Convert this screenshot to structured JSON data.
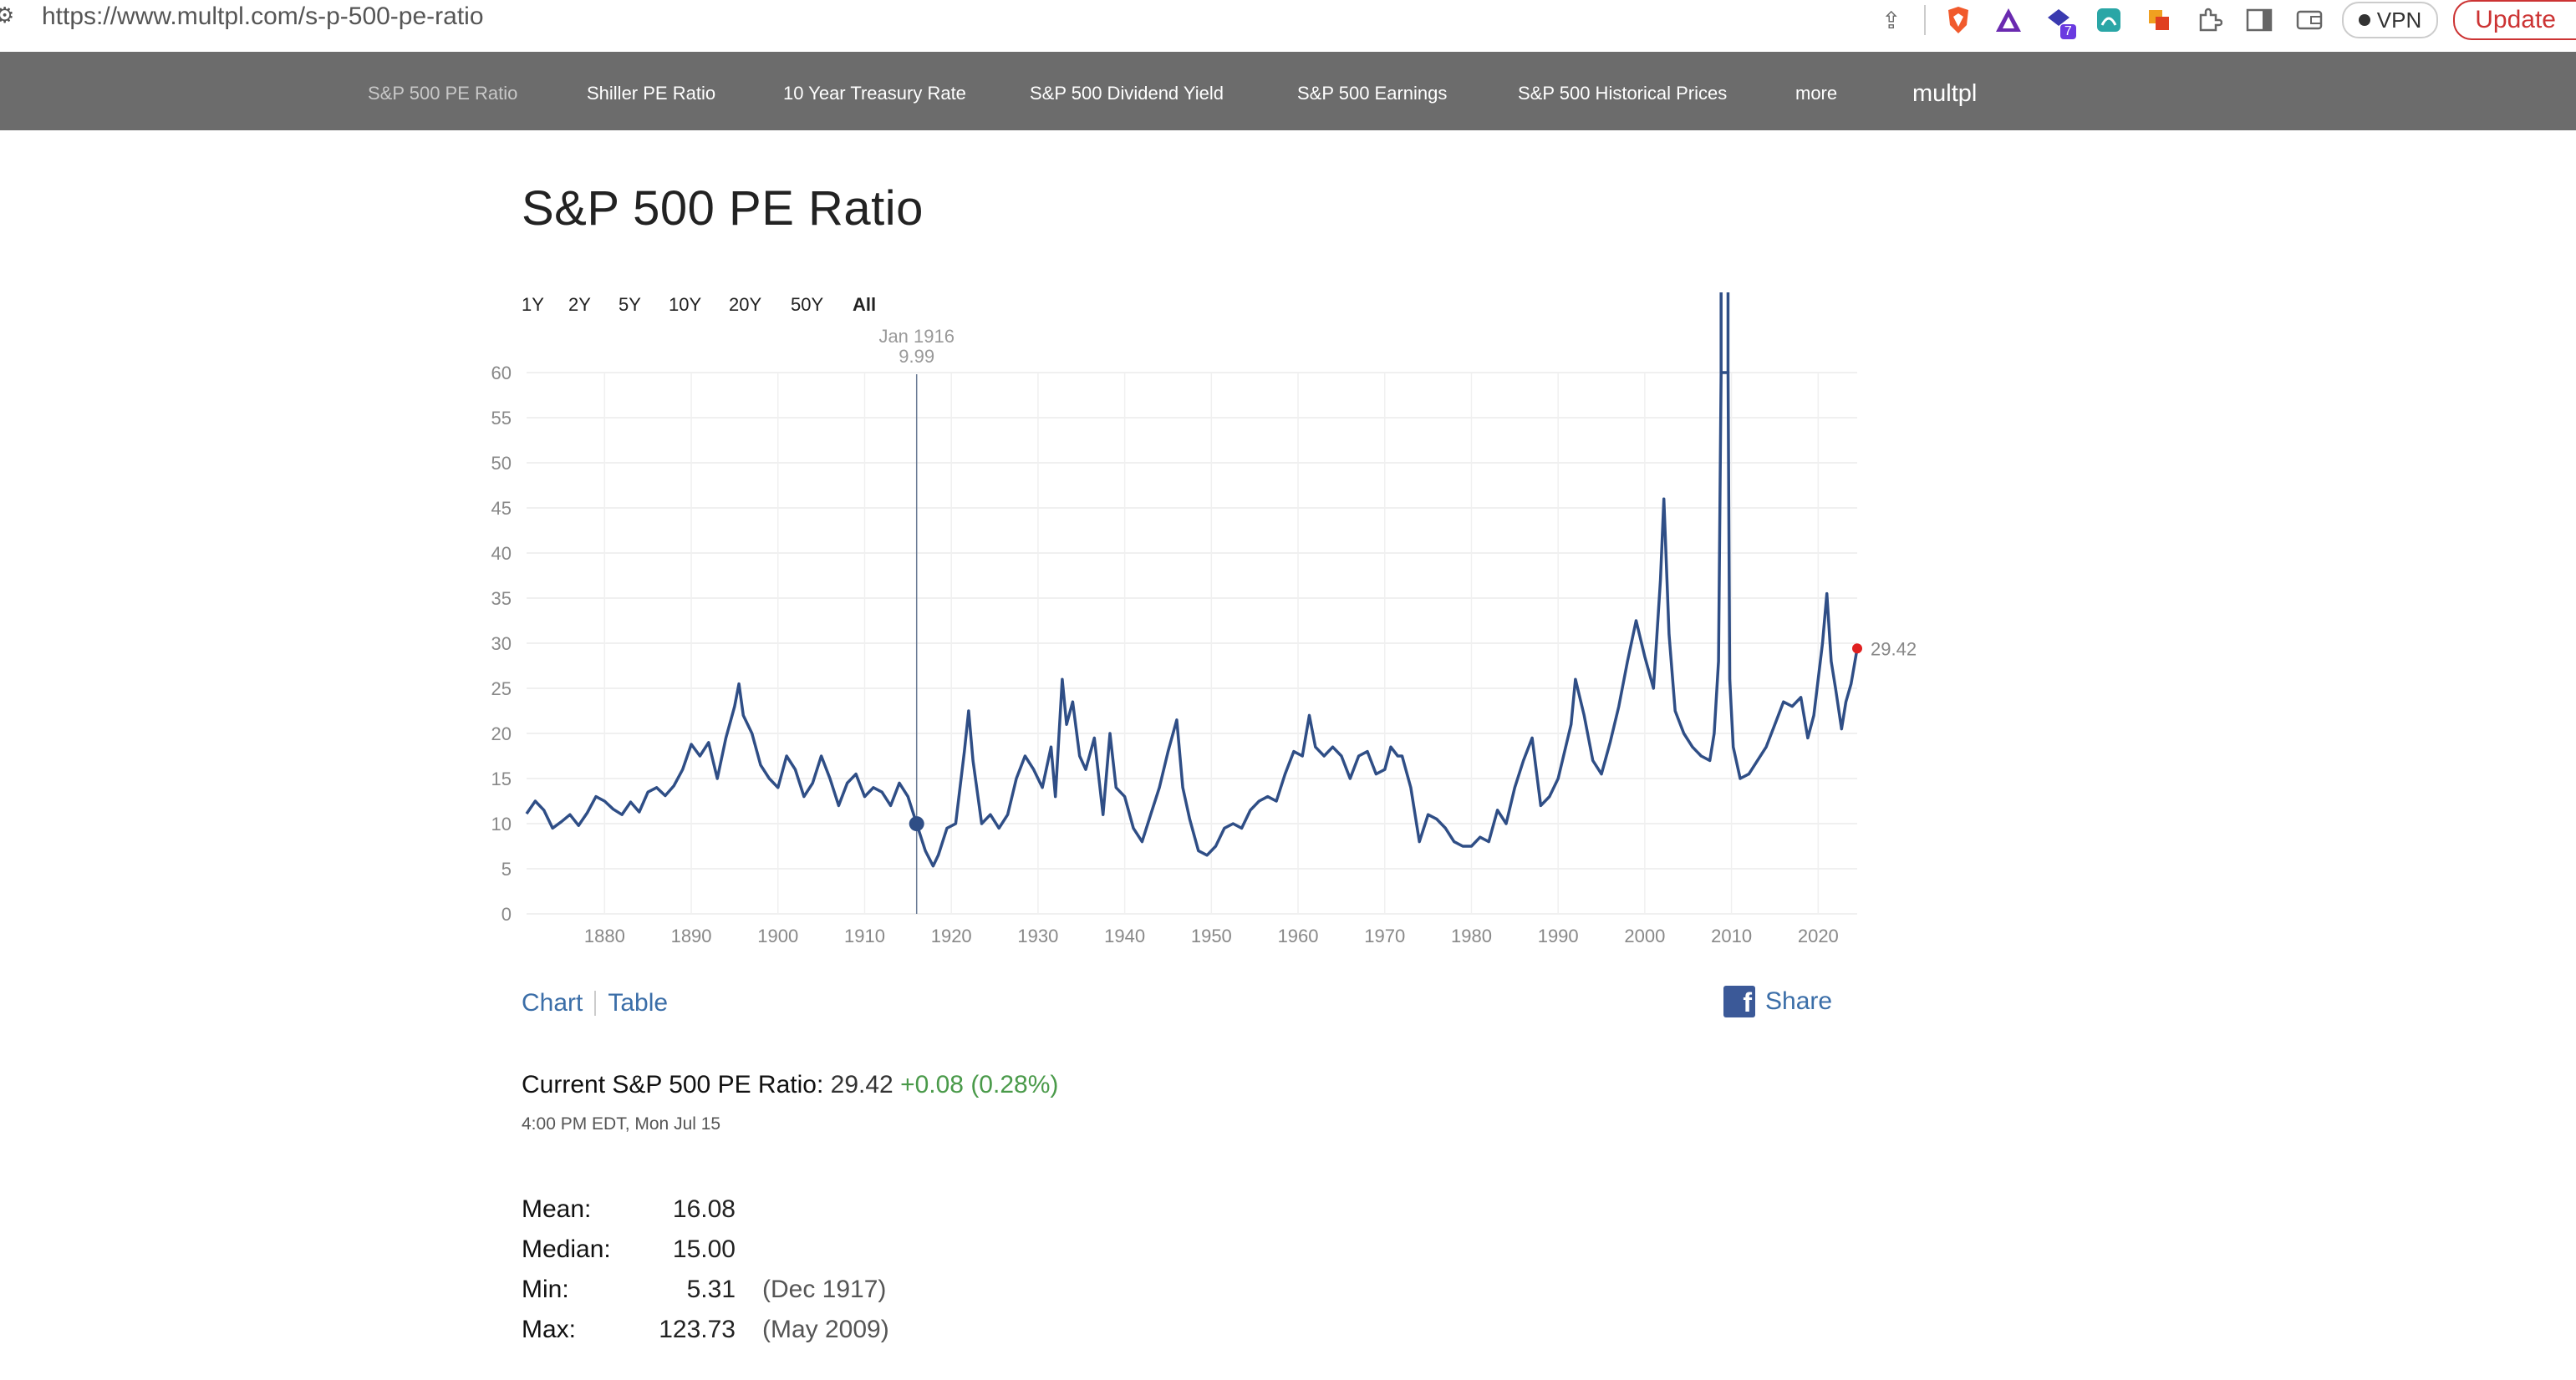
{
  "browser": {
    "url": "https://www.multpl.com/s-p-500-pe-ratio",
    "vpn_label": "VPN",
    "update_label": "Update",
    "extension_badge": "7"
  },
  "nav": {
    "items": [
      {
        "label": "S&P 500 PE Ratio",
        "active": true
      },
      {
        "label": "Shiller PE Ratio"
      },
      {
        "label": "10 Year Treasury Rate"
      },
      {
        "label": "S&P 500 Dividend Yield"
      },
      {
        "label": "S&P 500 Earnings"
      },
      {
        "label": "S&P 500 Historical Prices"
      },
      {
        "label": "more"
      }
    ],
    "brand": "multpl"
  },
  "page": {
    "title": "S&P 500 PE Ratio",
    "ranges": [
      "1Y",
      "2Y",
      "5Y",
      "10Y",
      "20Y",
      "50Y",
      "All"
    ],
    "selected_range": "All",
    "view_toggle": {
      "chart": "Chart",
      "table": "Table"
    },
    "share_label": "Share"
  },
  "current": {
    "label": "Current S&P 500 PE Ratio:",
    "value": "29.42",
    "change": "+0.08 (0.28%)",
    "timestamp": "4:00 PM EDT, Mon Jul 15"
  },
  "stats": [
    {
      "label": "Mean:",
      "value": "16.08",
      "date": ""
    },
    {
      "label": "Median:",
      "value": "15.00",
      "date": ""
    },
    {
      "label": "Min:",
      "value": "5.31",
      "date": "(Dec 1917)"
    },
    {
      "label": "Max:",
      "value": "123.73",
      "date": "(May 2009)"
    }
  ],
  "colors": {
    "line": "#2f4e86",
    "last_point": "#e02020",
    "nav_bg": "#6c6c6c",
    "link": "#3b6ea8",
    "change_positive": "#4a9a4a"
  },
  "chart_data": {
    "type": "line",
    "xlabel": "",
    "ylabel": "",
    "xlim": [
      1871,
      2024.5
    ],
    "ylim": [
      0,
      60
    ],
    "y_ticks": [
      0,
      5,
      10,
      15,
      20,
      25,
      30,
      35,
      40,
      45,
      50,
      55,
      60
    ],
    "x_ticks": [
      1880,
      1890,
      1900,
      1910,
      1920,
      1930,
      1940,
      1950,
      1960,
      1970,
      1980,
      1990,
      2000,
      2010,
      2020
    ],
    "grid": true,
    "tooltip": {
      "date": "Jan 1916",
      "value": "9.99",
      "x": 1916.0,
      "y": 9.99
    },
    "last_value_label": "29.42",
    "series": [
      {
        "points": [
          [
            1871.0,
            11.1
          ],
          [
            1872.0,
            12.5
          ],
          [
            1873.0,
            11.5
          ],
          [
            1874.0,
            9.5
          ],
          [
            1875.0,
            10.2
          ],
          [
            1876.0,
            11.0
          ],
          [
            1877.0,
            9.8
          ],
          [
            1878.0,
            11.2
          ],
          [
            1879.0,
            13.0
          ],
          [
            1880.0,
            12.5
          ],
          [
            1881.0,
            11.6
          ],
          [
            1882.0,
            11.0
          ],
          [
            1883.0,
            12.4
          ],
          [
            1884.0,
            11.3
          ],
          [
            1885.0,
            13.5
          ],
          [
            1886.0,
            14.0
          ],
          [
            1887.0,
            13.1
          ],
          [
            1888.0,
            14.2
          ],
          [
            1889.0,
            16.0
          ],
          [
            1890.0,
            18.8
          ],
          [
            1891.0,
            17.5
          ],
          [
            1892.0,
            19.0
          ],
          [
            1893.0,
            15.0
          ],
          [
            1894.0,
            19.5
          ],
          [
            1895.0,
            23.0
          ],
          [
            1895.5,
            25.5
          ],
          [
            1896.0,
            22.0
          ],
          [
            1897.0,
            20.0
          ],
          [
            1898.0,
            16.5
          ],
          [
            1899.0,
            15.0
          ],
          [
            1900.0,
            14.0
          ],
          [
            1901.0,
            17.5
          ],
          [
            1902.0,
            16.0
          ],
          [
            1903.0,
            13.0
          ],
          [
            1904.0,
            14.5
          ],
          [
            1905.0,
            17.5
          ],
          [
            1906.0,
            15.0
          ],
          [
            1907.0,
            12.0
          ],
          [
            1908.0,
            14.5
          ],
          [
            1909.0,
            15.5
          ],
          [
            1910.0,
            13.0
          ],
          [
            1911.0,
            14.0
          ],
          [
            1912.0,
            13.5
          ],
          [
            1913.0,
            12.0
          ],
          [
            1914.0,
            14.5
          ],
          [
            1915.0,
            13.0
          ],
          [
            1916.0,
            9.99
          ],
          [
            1917.0,
            7.0
          ],
          [
            1917.9,
            5.31
          ],
          [
            1918.5,
            6.5
          ],
          [
            1919.5,
            9.5
          ],
          [
            1920.5,
            10.0
          ],
          [
            1921.5,
            18.0
          ],
          [
            1922.0,
            22.5
          ],
          [
            1922.5,
            17.0
          ],
          [
            1923.5,
            10.0
          ],
          [
            1924.5,
            11.0
          ],
          [
            1925.5,
            9.5
          ],
          [
            1926.5,
            11.0
          ],
          [
            1927.5,
            15.0
          ],
          [
            1928.5,
            17.5
          ],
          [
            1929.5,
            16.0
          ],
          [
            1930.5,
            14.0
          ],
          [
            1931.5,
            18.5
          ],
          [
            1932.0,
            13.0
          ],
          [
            1932.8,
            26.0
          ],
          [
            1933.3,
            21.0
          ],
          [
            1934.0,
            23.5
          ],
          [
            1934.8,
            17.5
          ],
          [
            1935.5,
            16.0
          ],
          [
            1936.5,
            19.5
          ],
          [
            1937.5,
            11.0
          ],
          [
            1938.3,
            20.0
          ],
          [
            1939.0,
            14.0
          ],
          [
            1940.0,
            13.0
          ],
          [
            1941.0,
            9.5
          ],
          [
            1942.0,
            8.0
          ],
          [
            1943.0,
            11.0
          ],
          [
            1944.0,
            14.0
          ],
          [
            1945.0,
            18.0
          ],
          [
            1946.0,
            21.5
          ],
          [
            1946.7,
            14.0
          ],
          [
            1947.5,
            10.5
          ],
          [
            1948.5,
            7.0
          ],
          [
            1949.5,
            6.5
          ],
          [
            1950.5,
            7.5
          ],
          [
            1951.5,
            9.5
          ],
          [
            1952.5,
            10.0
          ],
          [
            1953.5,
            9.5
          ],
          [
            1954.5,
            11.5
          ],
          [
            1955.5,
            12.5
          ],
          [
            1956.5,
            13.0
          ],
          [
            1957.5,
            12.5
          ],
          [
            1958.5,
            15.5
          ],
          [
            1959.5,
            18.0
          ],
          [
            1960.5,
            17.5
          ],
          [
            1961.3,
            22.0
          ],
          [
            1962.0,
            18.5
          ],
          [
            1963.0,
            17.5
          ],
          [
            1964.0,
            18.5
          ],
          [
            1965.0,
            17.5
          ],
          [
            1966.0,
            15.0
          ],
          [
            1967.0,
            17.5
          ],
          [
            1968.0,
            18.0
          ],
          [
            1969.0,
            15.5
          ],
          [
            1970.0,
            16.0
          ],
          [
            1970.7,
            18.5
          ],
          [
            1971.5,
            17.5
          ],
          [
            1972.0,
            17.5
          ],
          [
            1973.0,
            14.0
          ],
          [
            1974.0,
            8.0
          ],
          [
            1975.0,
            11.0
          ],
          [
            1976.0,
            10.5
          ],
          [
            1977.0,
            9.5
          ],
          [
            1978.0,
            8.0
          ],
          [
            1979.0,
            7.5
          ],
          [
            1980.0,
            7.5
          ],
          [
            1981.0,
            8.5
          ],
          [
            1982.0,
            8.0
          ],
          [
            1983.0,
            11.5
          ],
          [
            1984.0,
            10.0
          ],
          [
            1985.0,
            14.0
          ],
          [
            1986.0,
            17.0
          ],
          [
            1987.0,
            19.5
          ],
          [
            1988.0,
            12.0
          ],
          [
            1989.0,
            13.0
          ],
          [
            1990.0,
            15.0
          ],
          [
            1991.5,
            21.0
          ],
          [
            1992.0,
            26.0
          ],
          [
            1993.0,
            22.0
          ],
          [
            1994.0,
            17.0
          ],
          [
            1995.0,
            15.5
          ],
          [
            1996.0,
            19.0
          ],
          [
            1997.0,
            23.0
          ],
          [
            1998.0,
            28.0
          ],
          [
            1999.0,
            32.5
          ],
          [
            2000.0,
            28.5
          ],
          [
            2001.0,
            25.0
          ],
          [
            2001.8,
            37.0
          ],
          [
            2002.2,
            46.0
          ],
          [
            2002.8,
            31.0
          ],
          [
            2003.5,
            22.5
          ],
          [
            2004.5,
            20.0
          ],
          [
            2005.5,
            18.5
          ],
          [
            2006.5,
            17.5
          ],
          [
            2007.5,
            17.0
          ],
          [
            2008.0,
            20.0
          ],
          [
            2008.5,
            28.0
          ],
          [
            2008.8,
            60.0
          ],
          [
            2009.6,
            60.0
          ],
          [
            2009.8,
            26.0
          ],
          [
            2010.2,
            18.5
          ],
          [
            2011.0,
            15.0
          ],
          [
            2012.0,
            15.5
          ],
          [
            2013.0,
            17.0
          ],
          [
            2014.0,
            18.5
          ],
          [
            2015.0,
            21.0
          ],
          [
            2016.0,
            23.5
          ],
          [
            2017.0,
            23.0
          ],
          [
            2018.0,
            24.0
          ],
          [
            2018.8,
            19.5
          ],
          [
            2019.5,
            22.0
          ],
          [
            2020.5,
            30.0
          ],
          [
            2021.0,
            35.5
          ],
          [
            2021.5,
            28.0
          ],
          [
            2022.0,
            25.0
          ],
          [
            2022.7,
            20.5
          ],
          [
            2023.2,
            23.5
          ],
          [
            2023.8,
            25.5
          ],
          [
            2024.5,
            29.42
          ]
        ]
      }
    ]
  }
}
